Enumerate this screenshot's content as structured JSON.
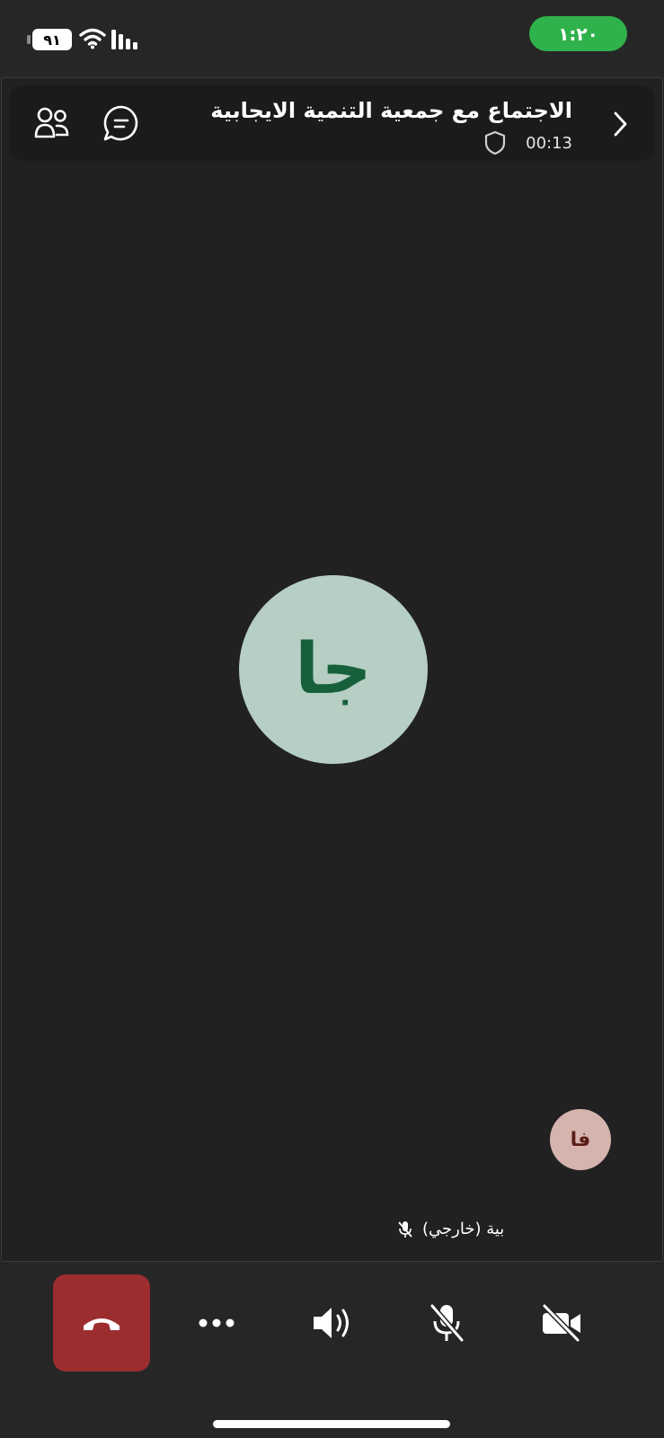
{
  "status_bar": {
    "battery_level": "٩١",
    "time": "١:٢٠",
    "time_pill_color": "#2fb14c"
  },
  "meeting": {
    "title": "الاجتماع مع جمعية التنمية الايجابية",
    "timer": "00:13"
  },
  "main_participant": {
    "initials": "جا",
    "avatar_bg": "#b6cec4",
    "avatar_fg": "#17603c"
  },
  "self_view": {
    "initials": "فا",
    "avatar_bg": "#d6b4ae"
  },
  "participant_label": {
    "name": "بية (خارجي)",
    "mic_state": "muted"
  },
  "controls": {
    "hangup_color": "#9c2d2f",
    "buttons": [
      "hang-up",
      "more",
      "speaker",
      "microphone-muted",
      "camera-off"
    ]
  },
  "icons": {
    "header": [
      "back-chevron-icon",
      "shield-icon",
      "chat-icon",
      "people-icon"
    ]
  }
}
